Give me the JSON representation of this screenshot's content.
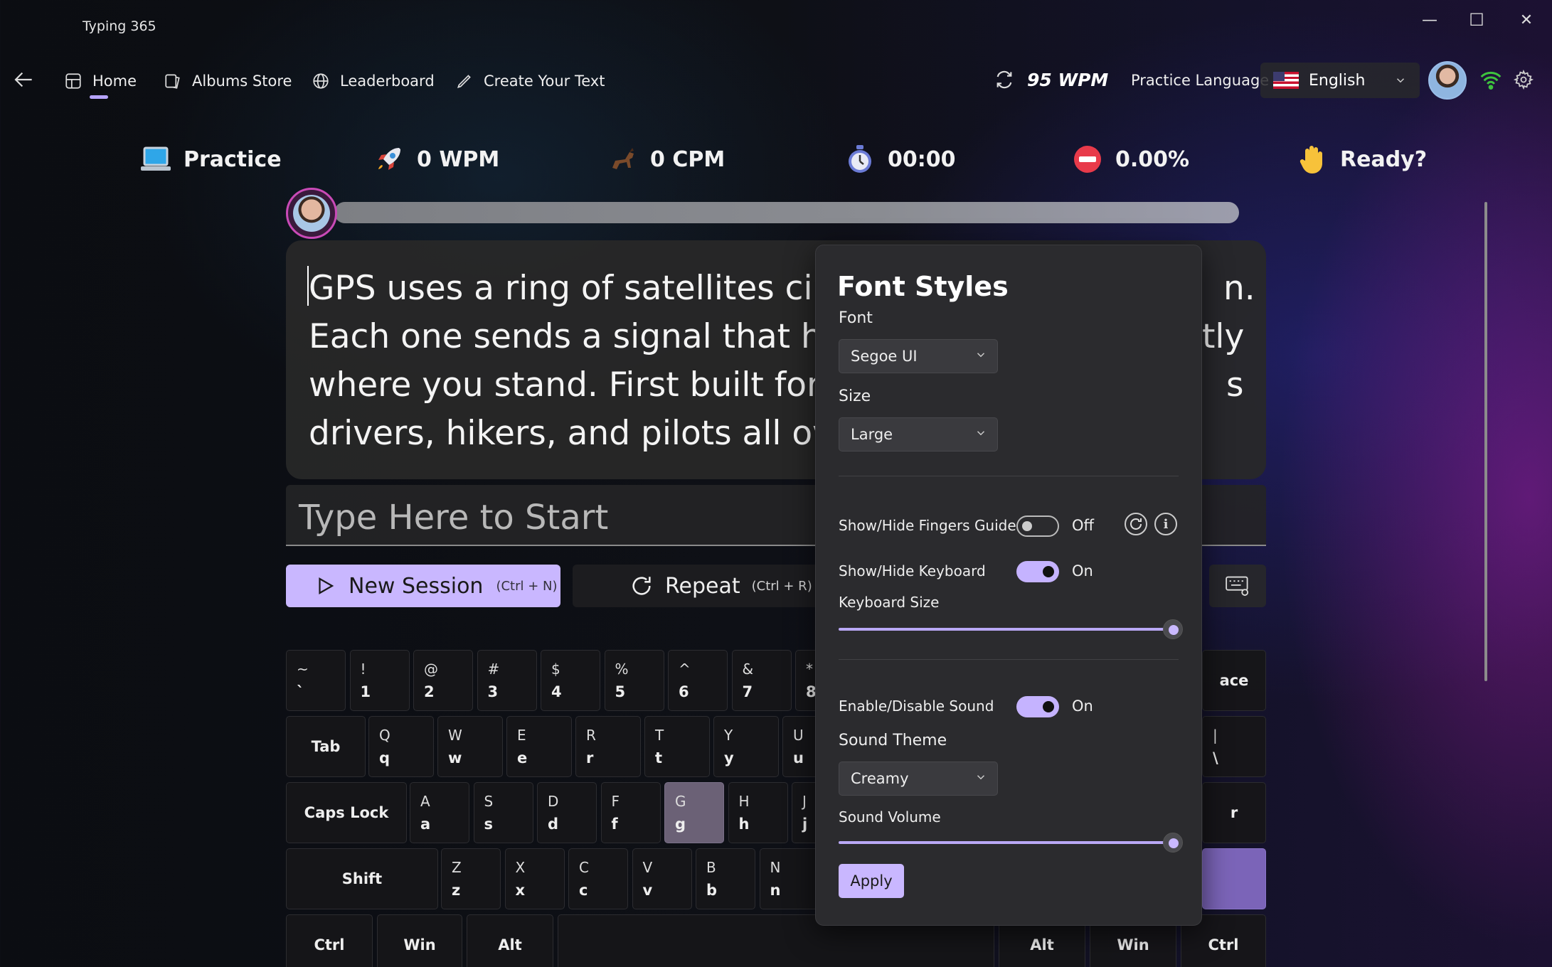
{
  "window": {
    "title": "Typing 365",
    "controls": {
      "minimize": "—",
      "maximize": "☐",
      "close": "✕"
    }
  },
  "nav": {
    "items": [
      {
        "label": "Home",
        "icon": "home-icon"
      },
      {
        "label": "Albums Store",
        "icon": "albums-icon"
      },
      {
        "label": "Leaderboard",
        "icon": "globe-icon"
      },
      {
        "label": "Create Your Text",
        "icon": "pen-icon"
      }
    ],
    "best_wpm": "95 WPM",
    "practice_language_label": "Practice Language",
    "language": "English"
  },
  "stats": {
    "mode": "Practice",
    "wpm": "0 WPM",
    "cpm": "0 CPM",
    "time": "00:00",
    "error_rate": "0.00%",
    "status": "Ready?"
  },
  "passage": {
    "line1": "GPS uses a ring of satellites circl",
    "line1_end": "n.",
    "line2": "Each one sends a signal that hel",
    "line2_end": "tly",
    "line3": "where you stand. First built for t",
    "line3_end": "s",
    "line4": "drivers, hikers, and pilots all ove"
  },
  "input": {
    "placeholder": "Type Here to Start"
  },
  "actions": {
    "new_session": "New Session",
    "new_session_shortcut": "(Ctrl + N)",
    "repeat": "Repeat",
    "repeat_shortcut": "(Ctrl + R)"
  },
  "keyboard": {
    "row1": [
      [
        "~",
        "`"
      ],
      [
        "!",
        "1"
      ],
      [
        "@",
        "2"
      ],
      [
        "#",
        "3"
      ],
      [
        "$",
        "4"
      ],
      [
        "%",
        "5"
      ],
      [
        "^",
        "6"
      ],
      [
        "&",
        "7"
      ],
      [
        "*",
        "8"
      ]
    ],
    "row2": [
      [
        "Q",
        "q"
      ],
      [
        "W",
        "w"
      ],
      [
        "E",
        "e"
      ],
      [
        "R",
        "r"
      ],
      [
        "T",
        "t"
      ],
      [
        "Y",
        "y"
      ],
      [
        "U",
        "u"
      ]
    ],
    "row3": [
      [
        "A",
        "a"
      ],
      [
        "S",
        "s"
      ],
      [
        "D",
        "d"
      ],
      [
        "F",
        "f"
      ],
      [
        "G",
        "g"
      ],
      [
        "H",
        "h"
      ],
      [
        "J",
        "j"
      ]
    ],
    "row4": [
      [
        "Z",
        "z"
      ],
      [
        "X",
        "x"
      ],
      [
        "C",
        "c"
      ],
      [
        "V",
        "v"
      ],
      [
        "B",
        "b"
      ],
      [
        "N",
        "n"
      ]
    ],
    "tab": "Tab",
    "caps": "Caps Lock",
    "shift": "Shift",
    "ctrl": "Ctrl",
    "win": "Win",
    "alt": "Alt",
    "backspace_partial": "ace",
    "pipe_top": "|",
    "pipe_bot": "\\",
    "enter_partial": "r",
    "right_alt": "Alt",
    "right_win": "Win",
    "right_ctrl": "Ctrl"
  },
  "font_styles": {
    "title": "Font Styles",
    "font_label": "Font",
    "font_value": "Segoe UI",
    "size_label": "Size",
    "size_value": "Large",
    "fingers_label": "Show/Hide Fingers Guide",
    "fingers_state": "Off",
    "keyboard_label": "Show/Hide Keyboard",
    "keyboard_state": "On",
    "keyboard_size_label": "Keyboard Size",
    "keyboard_size_value": 1.0,
    "sound_label": "Enable/Disable Sound",
    "sound_state": "On",
    "sound_theme_label": "Sound Theme",
    "sound_theme_value": "Creamy",
    "sound_volume_label": "Sound Volume",
    "sound_volume_value": 1.0,
    "apply": "Apply"
  },
  "colors": {
    "accent": "#c9b7ff",
    "panel": "#2b2b2e",
    "wifi": "#3ec43e"
  }
}
